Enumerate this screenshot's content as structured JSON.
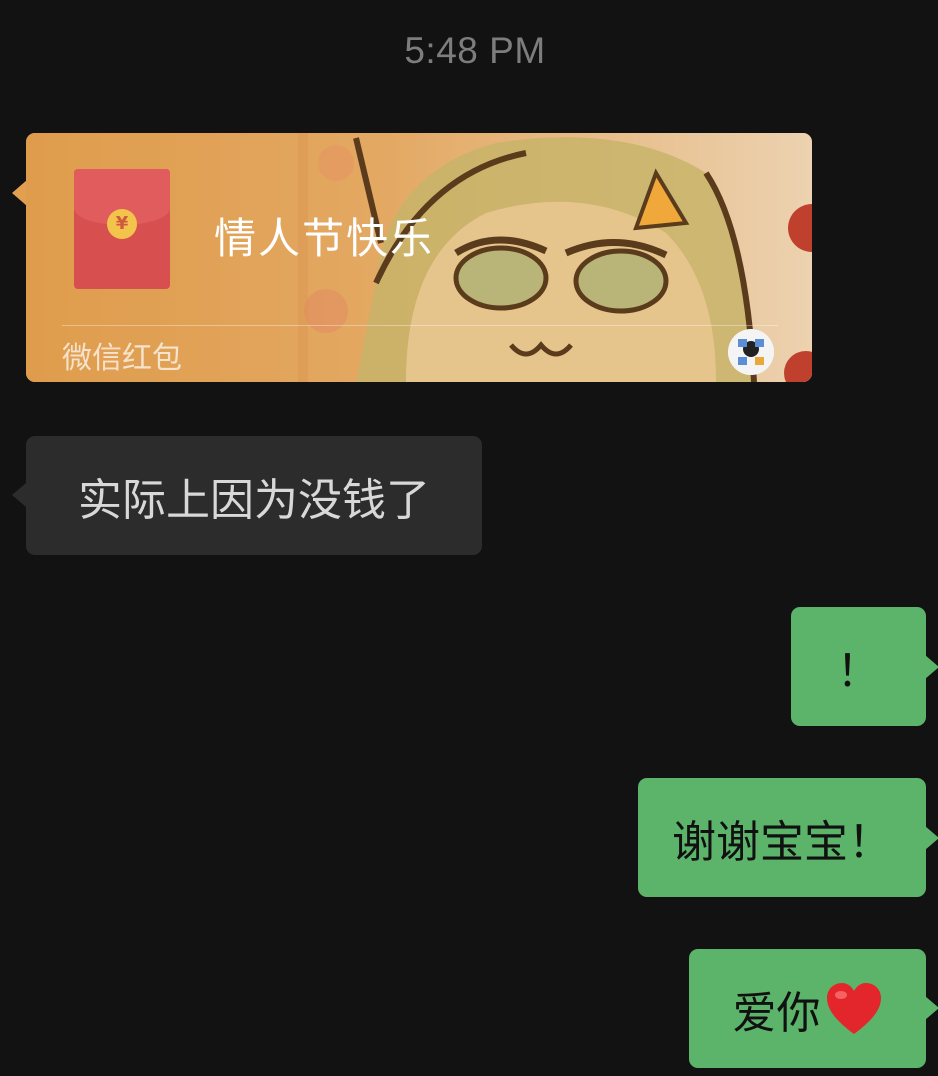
{
  "timestamp": "5:48 PM",
  "red_packet": {
    "title": "情人节快乐",
    "coin_symbol": "¥",
    "footer_label": "微信红包",
    "card_color": "#e1a050",
    "envelope_color": "#d74f4f"
  },
  "messages": [
    {
      "direction": "incoming",
      "text": "实际上因为没钱了"
    },
    {
      "direction": "outgoing",
      "text": "！"
    },
    {
      "direction": "outgoing",
      "text": "谢谢宝宝！"
    },
    {
      "direction": "outgoing",
      "text": "爱你",
      "emoji": "red-heart-icon"
    }
  ],
  "colors": {
    "background": "#121212",
    "incoming_bubble": "#2c2c2c",
    "outgoing_bubble": "#5cb46a"
  }
}
